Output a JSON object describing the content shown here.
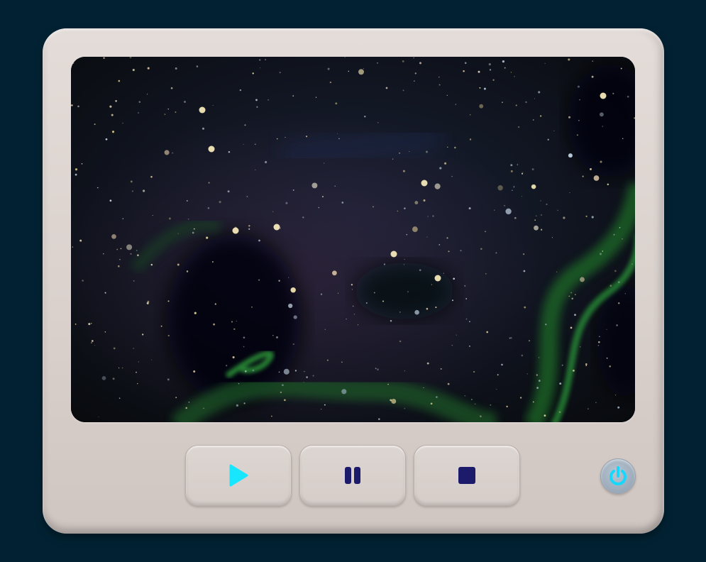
{
  "player": {
    "state": "playing",
    "screen": {
      "content": "space-nebula-video-frame"
    },
    "controls": [
      {
        "id": "play",
        "icon": "play-icon",
        "color": "#18e6ff"
      },
      {
        "id": "pause",
        "icon": "pause-icon",
        "color": "#1c1a6b"
      },
      {
        "id": "stop",
        "icon": "stop-icon",
        "color": "#1c1a6b"
      }
    ],
    "power": {
      "icon": "power-icon",
      "color": "#15d8ff"
    }
  },
  "colors": {
    "background": "#022233",
    "body": "#dad1cd",
    "screen": "#0b0f14",
    "accent": "#18e6ff",
    "icon_dark": "#1c1a6b"
  }
}
